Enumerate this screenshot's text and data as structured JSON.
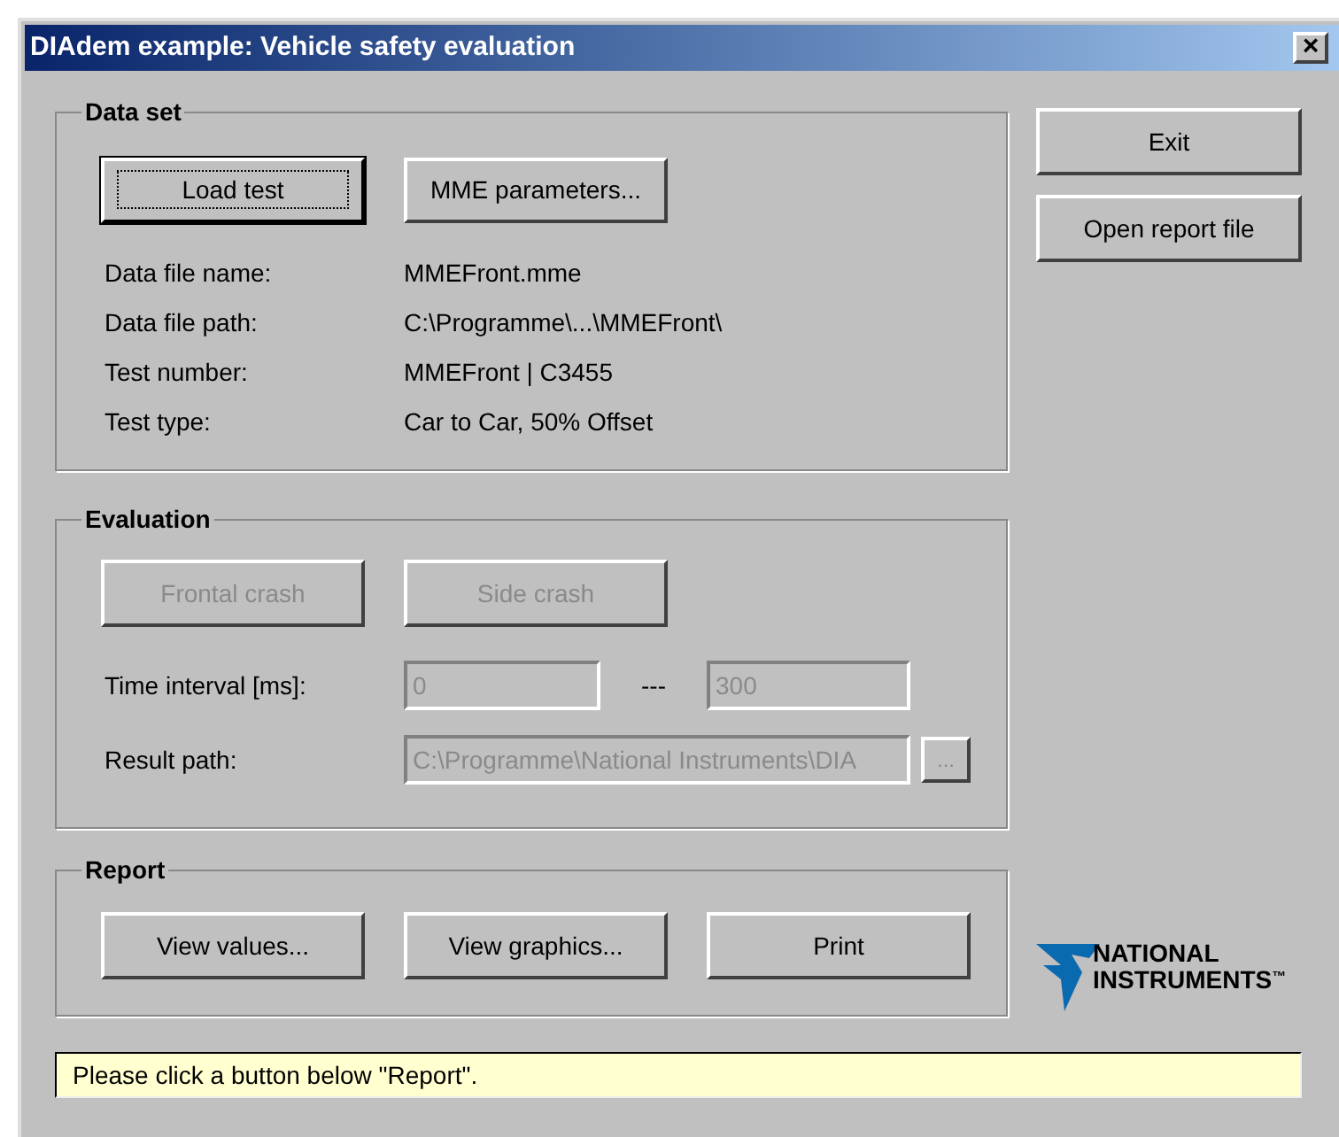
{
  "window": {
    "title": "DIAdem example: Vehicle safety evaluation",
    "close": "×"
  },
  "data_set": {
    "title": "Data set",
    "buttons": [
      {
        "label": "Load test",
        "focused": true,
        "disabled": false
      },
      {
        "label": "MME parameters...",
        "focused": false,
        "disabled": false
      }
    ],
    "fields": [
      {
        "label": "Data file name:",
        "value": "MMEFront.mme"
      },
      {
        "label": "Data file path:",
        "value": "C:\\Programme\\...\\MMEFront\\"
      },
      {
        "label": "Test number:",
        "value": "MMEFront | C3455"
      },
      {
        "label": "Test type:",
        "value": "Car to Car, 50% Offset"
      }
    ]
  },
  "side_buttons": [
    {
      "label": "Exit"
    },
    {
      "label": "Open report file"
    }
  ],
  "evaluation": {
    "title": "Evaluation",
    "buttons": [
      {
        "label": "Frontal crash",
        "focused": false,
        "disabled": true
      },
      {
        "label": "Side crash",
        "focused": false,
        "disabled": true
      }
    ],
    "time_interval": {
      "label": "Time interval [ms]:",
      "from": "0",
      "separator": "---",
      "to": "300",
      "disabled": true
    },
    "result_path": {
      "label": "Result path:",
      "value": "C:\\Programme\\National Instruments\\DIA",
      "browse": "...",
      "disabled": true
    }
  },
  "report": {
    "title": "Report",
    "buttons": [
      {
        "label": "View values...",
        "focused": false,
        "disabled": false
      },
      {
        "label": "View graphics...",
        "focused": false,
        "disabled": false
      },
      {
        "label": "Print",
        "focused": false,
        "disabled": false
      }
    ]
  },
  "logo": {
    "line_1": "NATIONAL",
    "line_2": "INSTRUMENTS",
    "mark": "™"
  },
  "status_bar": "Please click a button below \"Report\"."
}
